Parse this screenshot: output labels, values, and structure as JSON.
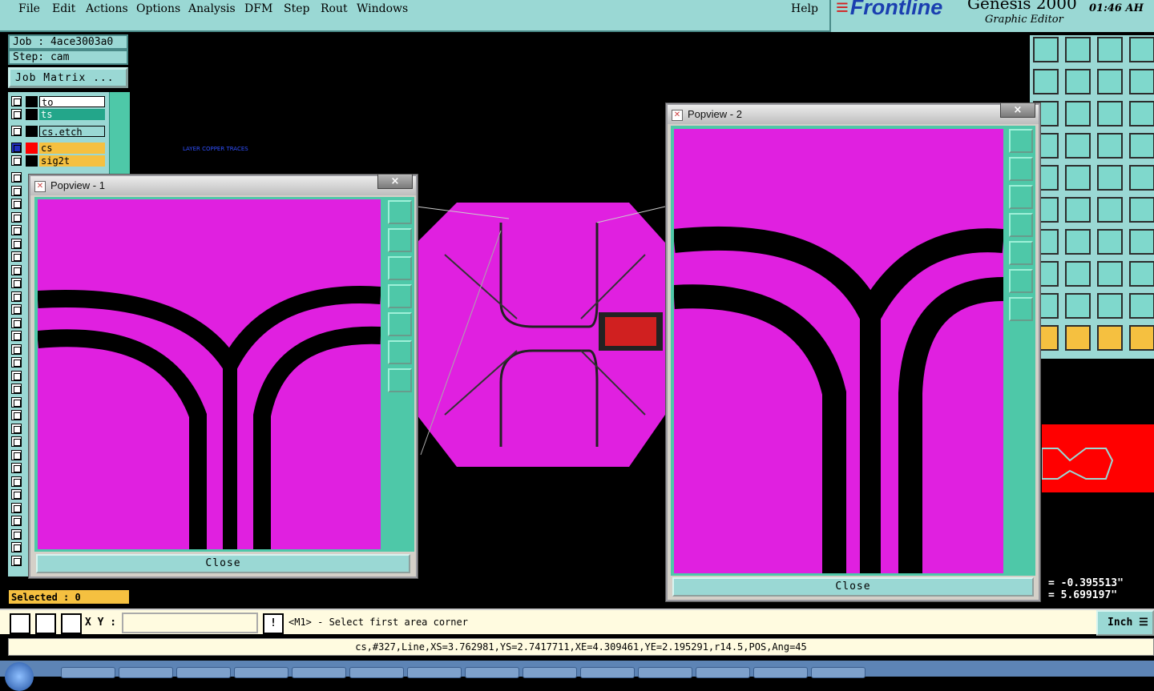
{
  "menu": {
    "items": [
      "File",
      "Edit",
      "Actions",
      "Options",
      "Analysis",
      "DFM",
      "Step",
      "Rout",
      "Windows"
    ],
    "help": "Help"
  },
  "brand": {
    "logo": "Frontline",
    "product": "Genesis 2000",
    "subtitle": "Graphic Editor",
    "clock": "01:46 AH"
  },
  "job": {
    "job_label": "Job : 4ace3003a0",
    "step_label": "Step: cam",
    "matrix_button": "Job Matrix ..."
  },
  "layers": [
    {
      "name": "to",
      "bg": "#ffffff",
      "swatch": "#000000"
    },
    {
      "name": "ts",
      "bg": "#23a68a",
      "swatch": "#000000"
    },
    {
      "name": "cs.etch",
      "bg": "#9ad8d4",
      "swatch": "#000000"
    },
    {
      "name": "cs",
      "bg": "#f5c040",
      "swatch": "#ff0000"
    },
    {
      "name": "sig2t",
      "bg": "#f5c040",
      "swatch": "#000000"
    }
  ],
  "canvas_label": "LAYER COPPER TRACES",
  "selected": "Selected : 0",
  "popview1": {
    "title": "Popview - 1",
    "close": "Close"
  },
  "popview2": {
    "title": "Popview - 2",
    "close": "Close"
  },
  "coords": {
    "x": "= -0.395513\"",
    "y": "= 5.699197\""
  },
  "command": {
    "xy_label": "X Y :",
    "input_value": "",
    "prompt": "<M1> - Select first area corner",
    "units": "Inch"
  },
  "status_line": "cs,#327,Line,XS=3.762981,YS=2.7417711,XE=4.309461,YE=2.195291,r14.5,POS,Ang=45",
  "colors": {
    "panel": "#9ad8d4",
    "copper": "#e020e0",
    "toolbar": "#4ec8a8",
    "highlight": "#f5c040"
  }
}
